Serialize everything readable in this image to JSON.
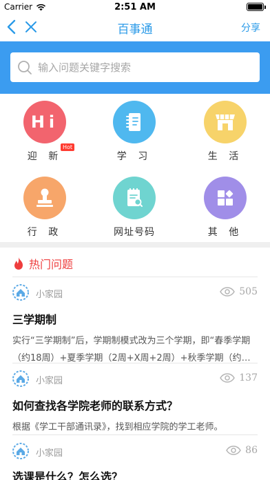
{
  "status_bar": {
    "carrier": "Carrier",
    "time": "2:51 AM"
  },
  "nav": {
    "title": "百事通",
    "share_label": "分享"
  },
  "search": {
    "placeholder": "输入问题关键字搜索"
  },
  "categories": [
    {
      "label": "迎 新",
      "icon": "hi-icon",
      "color": "#f2646e",
      "badge": "Hot"
    },
    {
      "label": "学 习",
      "icon": "notebook-icon",
      "color": "#4fb8ef"
    },
    {
      "label": "生 活",
      "icon": "store-icon",
      "color": "#f7d36a"
    },
    {
      "label": "行 政",
      "icon": "stamp-icon",
      "color": "#f7a66a"
    },
    {
      "label": "网址号码",
      "icon": "document-search-icon",
      "color": "#6fd4d0"
    },
    {
      "label": "其 他",
      "icon": "apps-icon",
      "color": "#a08ee8"
    }
  ],
  "hot_section": {
    "title": "热门问题"
  },
  "questions": [
    {
      "author": "小家园",
      "views": "505",
      "title": "三学期制",
      "body": "实行“三学期制”后，学期制模式改为三个学期，即“春季学期（约18周）+夏季学期（2周+X周+2周）+秋季学期（约18..."
    },
    {
      "author": "小家园",
      "views": "137",
      "title": "如何查找各学院老师的联系方式？",
      "body": "根据《学工干部通讯录》，找到相应学院的学工老师。"
    },
    {
      "author": "小家园",
      "views": "86",
      "title": "选课是什么？怎么选？",
      "body": ""
    }
  ],
  "colors": {
    "accent": "#2a9ae8",
    "search_band": "#3b9cf0",
    "hot_red": "#ee3d3d"
  }
}
